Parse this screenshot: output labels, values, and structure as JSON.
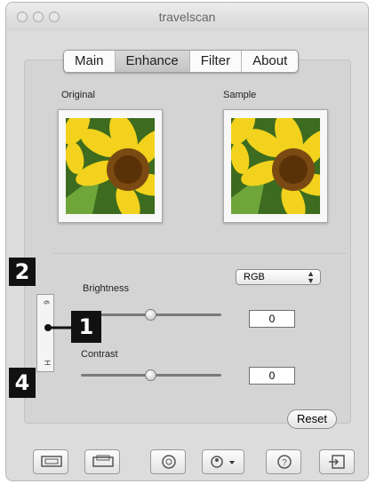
{
  "window": {
    "title": "travelscan"
  },
  "tabs": [
    {
      "label": "Main"
    },
    {
      "label": "Enhance"
    },
    {
      "label": "Filter"
    },
    {
      "label": "About"
    }
  ],
  "active_tab": "Enhance",
  "previews": {
    "original_label": "Original",
    "sample_label": "Sample"
  },
  "color_mode": {
    "selected": "RGB"
  },
  "brightness": {
    "label": "Brightness",
    "value": "0"
  },
  "contrast": {
    "label": "Contrast",
    "value": "0"
  },
  "reset_label": "Reset",
  "callouts": [
    "2",
    "1",
    "4"
  ],
  "toolbar": {
    "icons": [
      "scan-icon",
      "preview-icon",
      "refresh-icon",
      "fullauto-icon",
      "help-icon",
      "quit-icon"
    ]
  },
  "colors": {
    "window_bg": "#dcdcdc",
    "callout": "#111111"
  }
}
